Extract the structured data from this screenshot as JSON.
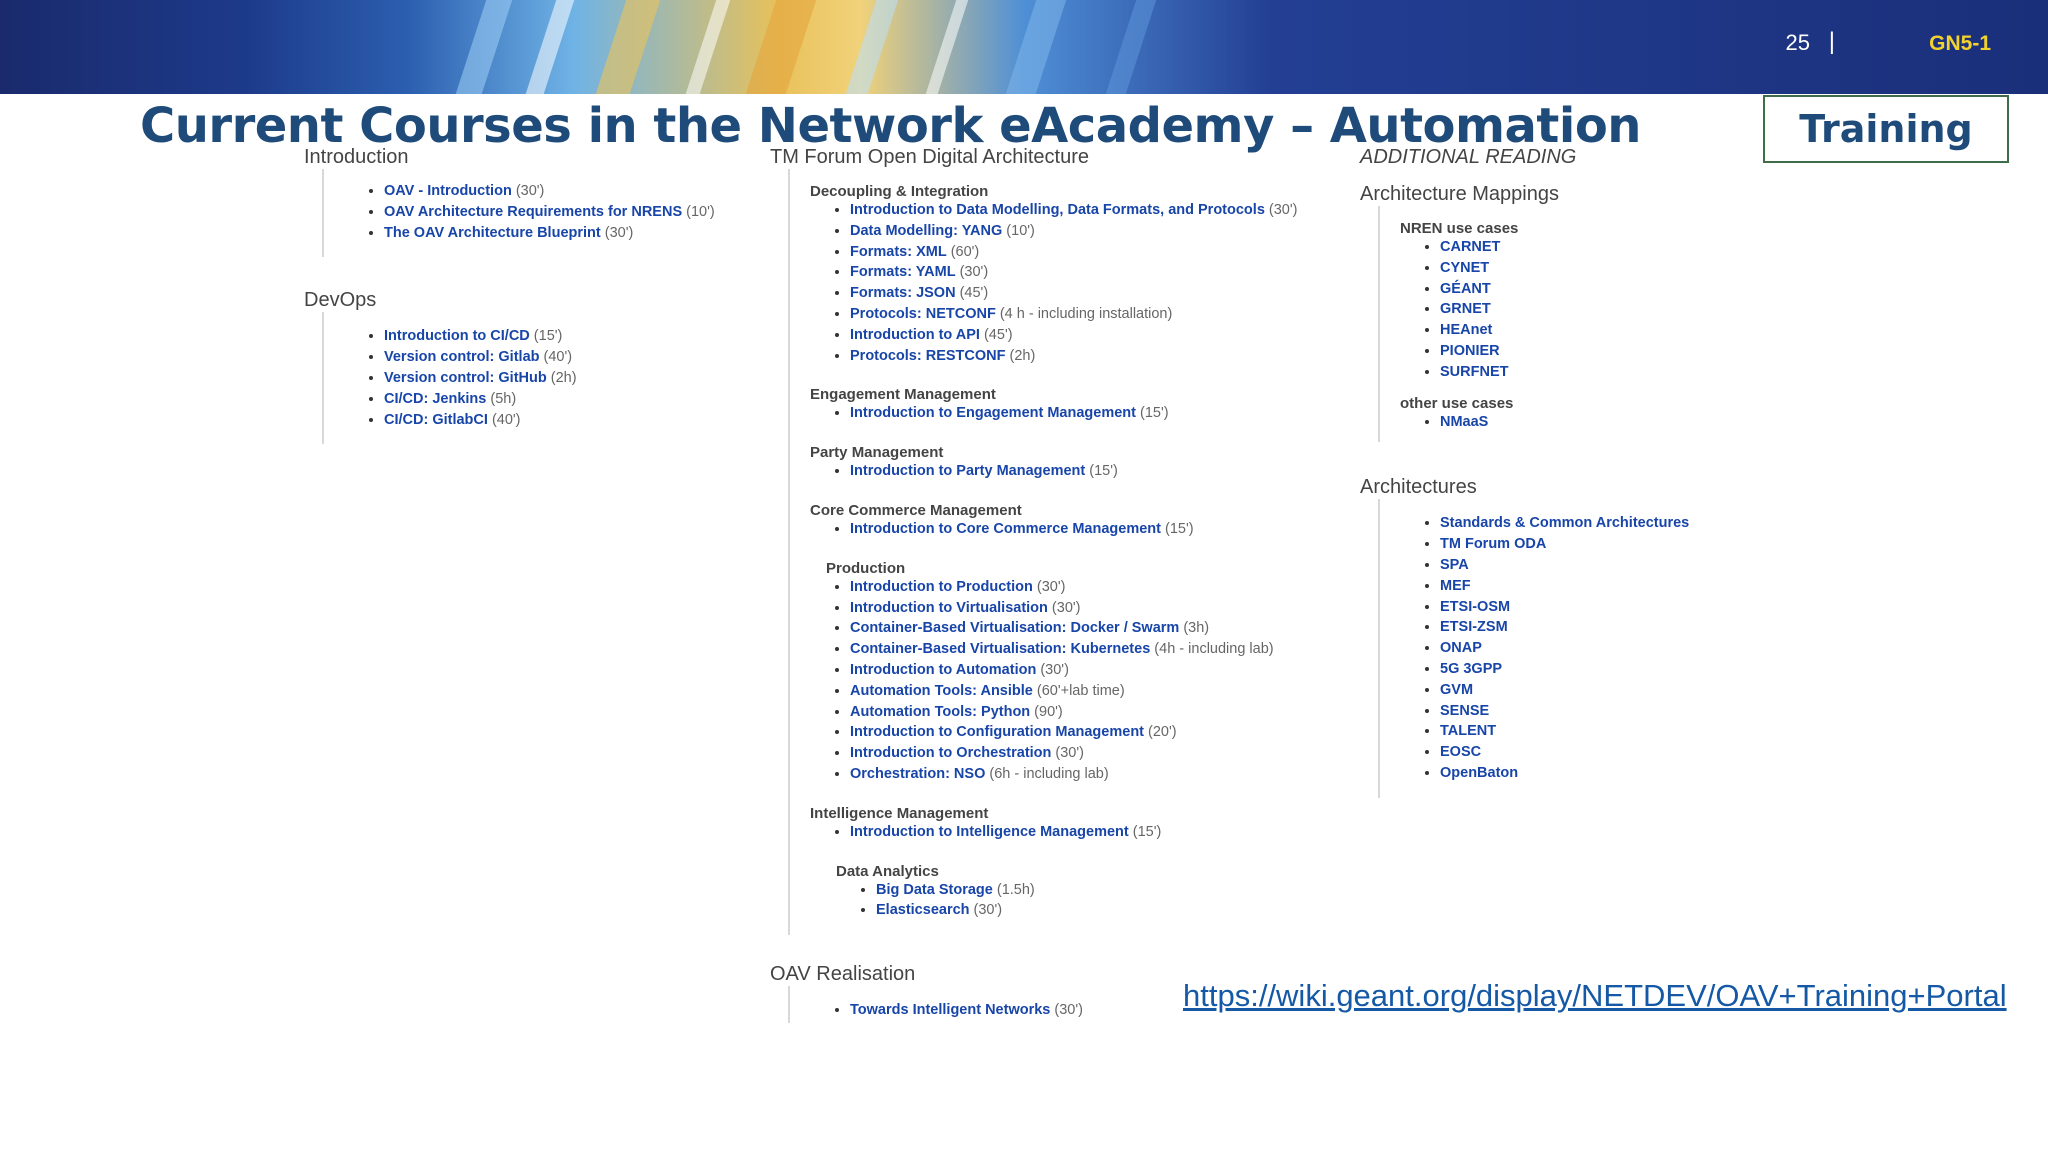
{
  "header": {
    "page_number": "25",
    "divider": "|",
    "code": "GN5-1"
  },
  "title": "Current Courses in the Network eAcademy – Automation",
  "badge": "Training",
  "col1": {
    "intro_heading": "Introduction",
    "intro_items": [
      {
        "link": "OAV - Introduction",
        "dur": " (30')"
      },
      {
        "link": "OAV Architecture Requirements for NRENS",
        "dur": " (10')"
      },
      {
        "link": "The OAV Architecture Blueprint",
        "dur": " (30')"
      }
    ],
    "devops_heading": "DevOps",
    "devops_items": [
      {
        "link": "Introduction to CI/CD",
        "dur": " (15')"
      },
      {
        "link": "Version control: Gitlab",
        "dur": " (40')"
      },
      {
        "link": "Version control: GitHub",
        "dur": " (2h)"
      },
      {
        "link": "CI/CD: Jenkins",
        "dur": " (5h)"
      },
      {
        "link": "CI/CD: GitlabCI",
        "dur": " (40')"
      }
    ]
  },
  "col2": {
    "heading": "TM Forum Open Digital Architecture",
    "groups": [
      {
        "name": "Decoupling & Integration",
        "items": [
          {
            "link": "Introduction to Data Modelling, Data Formats, and Protocols",
            "dur": " (30')"
          },
          {
            "link": "Data Modelling: YANG",
            "dur": " (10')"
          },
          {
            "link": "Formats: XML",
            "dur": " (60')"
          },
          {
            "link": "Formats: YAML",
            "dur": " (30')"
          },
          {
            "link": "Formats: JSON",
            "dur": " (45')"
          },
          {
            "link": "Protocols: NETCONF",
            "dur": " (4 h - including installation)"
          },
          {
            "link": "Introduction to API",
            "dur": " (45')"
          },
          {
            "link": "Protocols: RESTCONF",
            "dur": " (2h)"
          }
        ]
      },
      {
        "name": "Engagement Management",
        "items": [
          {
            "link": "Introduction to Engagement Management",
            "dur": " (15')"
          }
        ]
      },
      {
        "name": "Party Management",
        "items": [
          {
            "link": "Introduction to Party Management",
            "dur": " (15')"
          }
        ]
      },
      {
        "name": "Core Commerce Management",
        "items": [
          {
            "link": "Introduction to Core Commerce Management",
            "dur": " (15')"
          }
        ]
      },
      {
        "name": "Production",
        "items": [
          {
            "link": "Introduction to Production",
            "dur": " (30')"
          },
          {
            "link": "Introduction to Virtualisation",
            "dur": " (30')"
          },
          {
            "link": "Container-Based Virtualisation: Docker / Swarm",
            "dur": " (3h)"
          },
          {
            "link": "Container-Based Virtualisation: Kubernetes",
            "dur": " (4h - including lab)"
          },
          {
            "link": "Introduction to Automation",
            "dur": " (30')"
          },
          {
            "link": "Automation Tools: Ansible",
            "dur": " (60'+lab time)"
          },
          {
            "link": "Automation Tools: Python",
            "dur": " (90')"
          },
          {
            "link": "Introduction to Configuration Management",
            "dur": " (20')"
          },
          {
            "link": "Introduction to Orchestration",
            "dur": " (30')"
          },
          {
            "link": "Orchestration: NSO",
            "dur": " (6h - including lab)"
          }
        ]
      },
      {
        "name": "Intelligence Management",
        "items": [
          {
            "link": "Introduction to Intelligence Management",
            "dur": " (15')"
          }
        ]
      },
      {
        "name": "Data Analytics",
        "items": [
          {
            "link": "Big Data Storage",
            "dur": " (1.5h)"
          },
          {
            "link": "Elasticsearch",
            "dur": " (30')"
          }
        ]
      }
    ],
    "realisation_heading": "OAV Realisation",
    "realisation_items": [
      {
        "link": "Towards Intelligent Networks",
        "dur": " (30')"
      }
    ]
  },
  "col3": {
    "additional": "ADDITIONAL READING",
    "mappings_heading": "Architecture Mappings",
    "nren_label": "NREN use cases",
    "nren_items": [
      "CARNET",
      "CYNET",
      "GÉANT",
      "GRNET",
      "HEAnet",
      "PIONIER",
      "SURFNET"
    ],
    "other_label": "other use cases",
    "other_items": [
      "NMaaS"
    ],
    "arch_heading": "Architectures",
    "arch_items": [
      "Standards & Common Architectures",
      "TM Forum ODA",
      "SPA",
      "MEF",
      "ETSI-OSM",
      "ETSI-ZSM",
      "ONAP",
      "5G 3GPP",
      "GVM",
      "SENSE",
      "TALENT",
      "EOSC",
      "OpenBaton"
    ]
  },
  "url": "https://wiki.geant.org/display/NETDEV/OAV+Training+Portal",
  "colors": {
    "banner": "#1a2a6c",
    "title": "#1f4b7a",
    "link": "#1845a8",
    "code": "#f2d22c"
  }
}
